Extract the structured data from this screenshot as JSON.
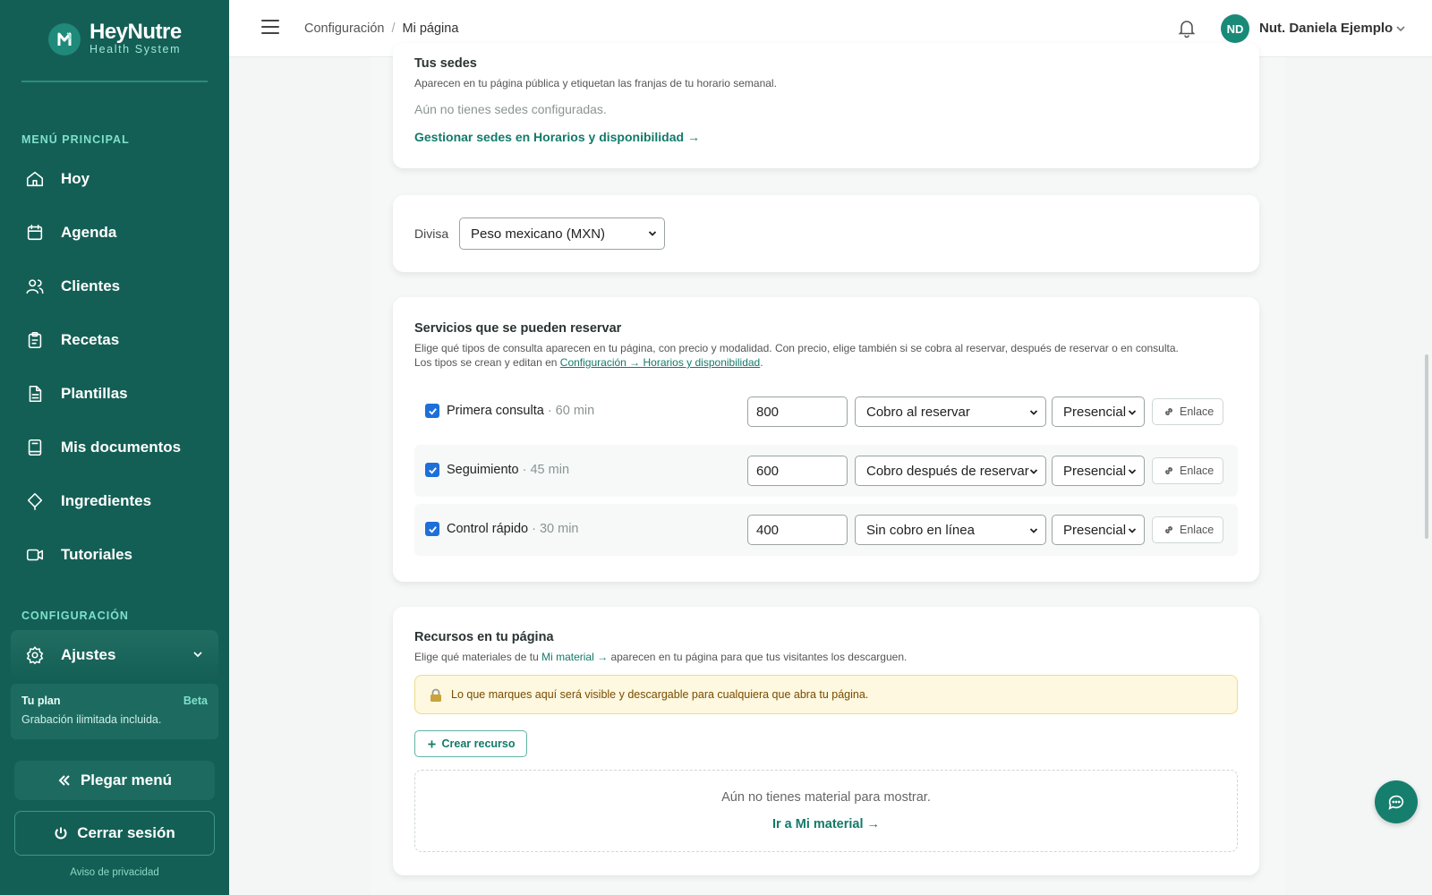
{
  "brand": {
    "name": "HeyNutre",
    "tagline": "Health System",
    "accent": "#145f55"
  },
  "sidebar": {
    "main_label": "MENÚ PRINCIPAL",
    "items": [
      {
        "label": "Hoy",
        "icon": "home-icon"
      },
      {
        "label": "Agenda",
        "icon": "calendar-icon"
      },
      {
        "label": "Clientes",
        "icon": "users-icon"
      },
      {
        "label": "Recetas",
        "icon": "clipboard-icon"
      },
      {
        "label": "Plantillas",
        "icon": "file-icon"
      },
      {
        "label": "Mis documentos",
        "icon": "book-icon"
      },
      {
        "label": "Ingredientes",
        "icon": "leaf-icon"
      },
      {
        "label": "Tutoriales",
        "icon": "video-icon"
      }
    ],
    "config_label": "CONFIGURACIÓN",
    "settings_label": "Ajustes",
    "plan": {
      "title": "Tu plan",
      "badge": "Beta",
      "description": "Grabación ilimitada incluida."
    },
    "collapse_label": "Plegar menú",
    "logout_label": "Cerrar sesión",
    "privacy_label": "Aviso de privacidad"
  },
  "header": {
    "breadcrumb": [
      "Configuración",
      "Mi página"
    ],
    "separator": "/",
    "user": {
      "initials": "ND",
      "name": "Nut. Daniela Ejemplo"
    }
  },
  "sedes": {
    "title": "Tus sedes",
    "description": "Aparecen en tu página pública y etiquetan las franjas de tu horario semanal.",
    "empty": "Aún no tienes sedes configuradas.",
    "manage_link": "Gestionar sedes en Horarios y disponibilidad →"
  },
  "currency": {
    "label": "Divisa",
    "selected": "Peso mexicano (MXN)"
  },
  "services": {
    "title": "Servicios que se pueden reservar",
    "description_1": "Elige qué tipos de consulta aparecen en tu página, con precio y modalidad. Con precio, elige también si se cobra al reservar, después de reservar o en consulta.",
    "description_2_prefix": "Los tipos se crean y editan en ",
    "description_2_link": "Configuración → Horarios y disponibilidad",
    "description_2_suffix": ".",
    "link_label": "Enlace",
    "rows": [
      {
        "name": "Primera consulta",
        "duration": " · 60 min",
        "price": "800",
        "payment": "Cobro al reservar",
        "mode": "Presencial",
        "checked": true
      },
      {
        "name": "Seguimiento",
        "duration": " · 45 min",
        "price": "600",
        "payment": "Cobro después de reservar",
        "mode": "Presencial",
        "checked": true
      },
      {
        "name": "Control rápido",
        "duration": " · 30 min",
        "price": "400",
        "payment": "Sin cobro en línea",
        "mode": "Presencial",
        "checked": true
      }
    ]
  },
  "resources": {
    "title": "Recursos en tu página",
    "desc_prefix": "Elige qué materiales de tu ",
    "desc_link": "Mi material →",
    "desc_suffix": " aparecen en tu página para que tus visitantes los descarguen.",
    "warning": "Lo que marques aquí será visible y descargable para cualquiera que abra tu página.",
    "create_label": "Crear recurso",
    "empty_text": "Aún no tienes material para mostrar.",
    "empty_link": "Ir a Mi material →"
  }
}
